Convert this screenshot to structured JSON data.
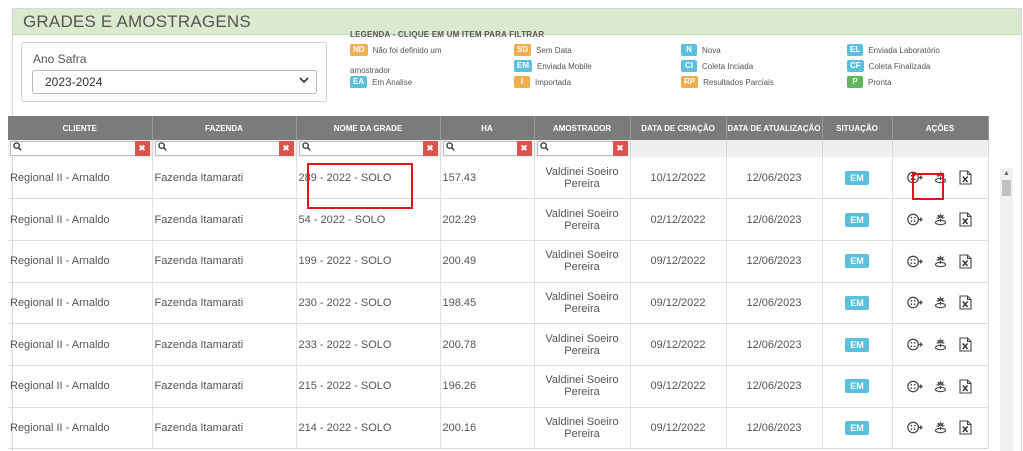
{
  "panel": {
    "title": "GRADES E AMOSTRAGENS"
  },
  "safra": {
    "label": "Ano Safra",
    "selected": "2023-2024"
  },
  "legend": {
    "title": "LEGENDA - CLIQUE EM UM ITEM PARA FILTRAR",
    "items": [
      {
        "code": "ND",
        "label": "Não foi definido um",
        "color": "#f0ad4e"
      },
      {
        "code": "SD",
        "label": "Sem Data",
        "color": "#f0ad4e"
      },
      {
        "code": "N",
        "label": "Nova",
        "color": "#5bc0de"
      },
      {
        "code": "EL",
        "label": "Enviada Laboratório",
        "color": "#5bc0de"
      },
      {
        "code": "EM",
        "label": "Enviada Mobile",
        "color": "#5bc0de"
      },
      {
        "code": "CI",
        "label": "Coleta Inciada",
        "color": "#5bc0de"
      },
      {
        "code": "CF",
        "label": "Coleta Finalizada",
        "color": "#5bc0de"
      },
      {
        "code": "EA",
        "label": "Em Analise",
        "color": "#5bc0de"
      },
      {
        "code": "I",
        "label": "Importada",
        "color": "#f0ad4e"
      },
      {
        "code": "RP",
        "label": "Resultados Parciais",
        "color": "#f0ad4e"
      },
      {
        "code": "P",
        "label": "Pronta",
        "color": "#5cb85c"
      }
    ],
    "extra_text": "amostrador"
  },
  "table": {
    "columns": [
      "CLIENTE",
      "FAZENDA",
      "NOME DA GRADE",
      "HA",
      "AMOSTRADOR",
      "DATA DE CRIAÇÃO",
      "DATA DE ATUALIZAÇÃO",
      "SITUAÇÃO",
      "AÇÕES"
    ],
    "rows": [
      {
        "cliente": "Regional II - Arnaldo",
        "fazenda": "Fazenda Itamarati",
        "grade": "289 - 2022 - SOLO",
        "ha": "157.43",
        "amostrador": "Valdinei Soeiro Pereira",
        "criacao": "10/12/2022",
        "atualizacao": "12/06/2023",
        "situacao": "EM"
      },
      {
        "cliente": "Regional II - Arnaldo",
        "fazenda": "Fazenda Itamarati",
        "grade": "54 - 2022 - SOLO",
        "ha": "202.29",
        "amostrador": "Valdinei Soeiro Pereira",
        "criacao": "02/12/2022",
        "atualizacao": "12/06/2023",
        "situacao": "EM"
      },
      {
        "cliente": "Regional II - Arnaldo",
        "fazenda": "Fazenda Itamarati",
        "grade": "199 - 2022 - SOLO",
        "ha": "200.49",
        "amostrador": "Valdinei Soeiro Pereira",
        "criacao": "09/12/2022",
        "atualizacao": "12/06/2023",
        "situacao": "EM"
      },
      {
        "cliente": "Regional II - Arnaldo",
        "fazenda": "Fazenda Itamarati",
        "grade": "230 - 2022 - SOLO",
        "ha": "198.45",
        "amostrador": "Valdinei Soeiro Pereira",
        "criacao": "09/12/2022",
        "atualizacao": "12/06/2023",
        "situacao": "EM"
      },
      {
        "cliente": "Regional II - Arnaldo",
        "fazenda": "Fazenda Itamarati",
        "grade": "233 - 2022 - SOLO",
        "ha": "200.78",
        "amostrador": "Valdinei Soeiro Pereira",
        "criacao": "09/12/2022",
        "atualizacao": "12/06/2023",
        "situacao": "EM"
      },
      {
        "cliente": "Regional II - Arnaldo",
        "fazenda": "Fazenda Itamarati",
        "grade": "215 - 2022 - SOLO",
        "ha": "196.26",
        "amostrador": "Valdinei Soeiro Pereira",
        "criacao": "09/12/2022",
        "atualizacao": "12/06/2023",
        "situacao": "EM"
      },
      {
        "cliente": "Regional II - Arnaldo",
        "fazenda": "Fazenda Itamarati",
        "grade": "214 - 2022 - SOLO",
        "ha": "200.16",
        "amostrador": "Valdinei Soeiro Pereira",
        "criacao": "09/12/2022",
        "atualizacao": "12/06/2023",
        "situacao": "EM"
      }
    ],
    "action_icons": [
      "sampling-points-icon",
      "soil-sample-icon",
      "excel-export-icon"
    ]
  },
  "colors": {
    "header_bg": "#7b7b7b",
    "panel_header_bg": "#dbe9cf",
    "situacao_badge": "#5bc0de",
    "filter_clear": "#d9534f",
    "highlight": "#e3131b"
  }
}
